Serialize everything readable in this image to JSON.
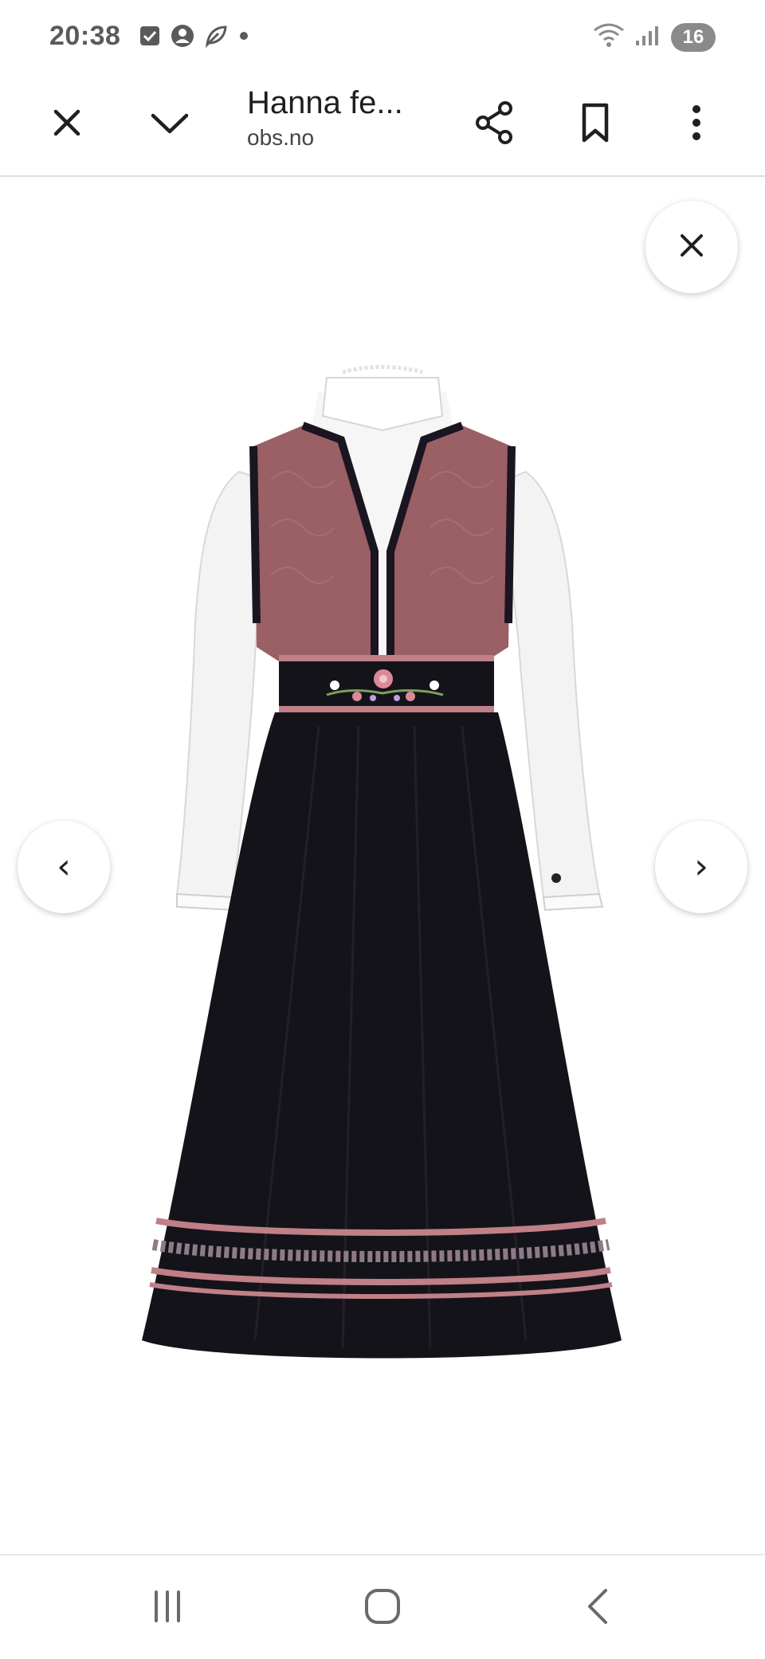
{
  "status_bar": {
    "time": "20:38",
    "battery": "16",
    "icons_left": [
      "checkbox-icon",
      "account-icon",
      "leaf-icon",
      "dot-icon"
    ],
    "icons_right": [
      "wifi-icon",
      "signal-icon",
      "battery-icon"
    ]
  },
  "toolbar": {
    "title": "Hanna fe...",
    "domain": "obs.no",
    "icons": [
      "close-icon",
      "chevron-down-icon",
      "share-icon",
      "bookmark-icon",
      "more-vert-icon"
    ]
  },
  "viewer": {
    "prev_label": "‹",
    "next_label": "›",
    "image_subject": "Bunad dress with white blouse, pink embroidered vest, black skirt with patterned hem"
  },
  "nav": {
    "icons": [
      "recents-icon",
      "home-icon",
      "back-icon"
    ]
  },
  "colors": {
    "vest": "#9b5f66",
    "skirt": "#15131a",
    "trim": "#c08088",
    "blouse": "#f5f5f5"
  }
}
